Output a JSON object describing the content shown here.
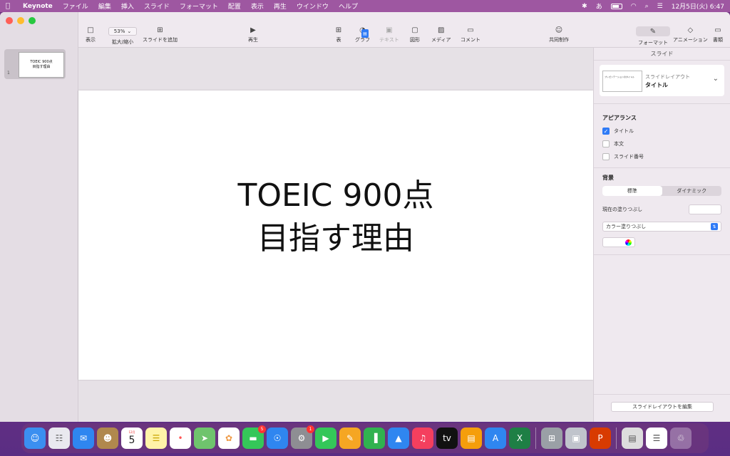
{
  "menubar": {
    "app": "Keynote",
    "items": [
      "ファイル",
      "編集",
      "挿入",
      "スライド",
      "フォーマット",
      "配置",
      "表示",
      "再生",
      "ウインドウ",
      "ヘルプ"
    ],
    "datetime": "12月5日(火) 6:47"
  },
  "sidebar": {
    "slide_thumb_line1": "TOEIC 900点",
    "slide_thumb_line2": "目指す理由",
    "slide_number": "1"
  },
  "toolbar": {
    "view_label": "表示",
    "zoom_value": "53%",
    "zoom_label": "拡大/縮小",
    "add_slide_label": "スライドを追加",
    "play_label": "再生",
    "table_label": "表",
    "chart_label": "グラフ",
    "text_label": "テキスト",
    "shape_label": "図形",
    "media_label": "メディア",
    "comment_label": "コメント",
    "collab_label": "共同制作",
    "format_label": "フォーマット",
    "animate_label": "アニメーション",
    "document_label": "書類"
  },
  "slide": {
    "title_line1": "TOEIC 900点",
    "title_line2": "目指す理由"
  },
  "inspector": {
    "header": "スライド",
    "layout_thumb_text": "プレゼンテーションのタイトル",
    "layout_label": "スライドレイアウト",
    "layout_value": "タイトル",
    "appearance_title": "アピアランス",
    "check_title": "タイトル",
    "check_body": "本文",
    "check_slide_number": "スライド番号",
    "background_title": "背景",
    "seg_standard": "標準",
    "seg_dynamic": "ダイナミック",
    "current_fill_label": "現在の塗りつぶし",
    "fill_type": "カラー塗りつぶし",
    "edit_layout_button": "スライドレイアウトを編集"
  },
  "dock": {
    "calendar_month": "12月",
    "calendar_day": "5",
    "messages_badge": "5",
    "settings_badge": "1"
  }
}
